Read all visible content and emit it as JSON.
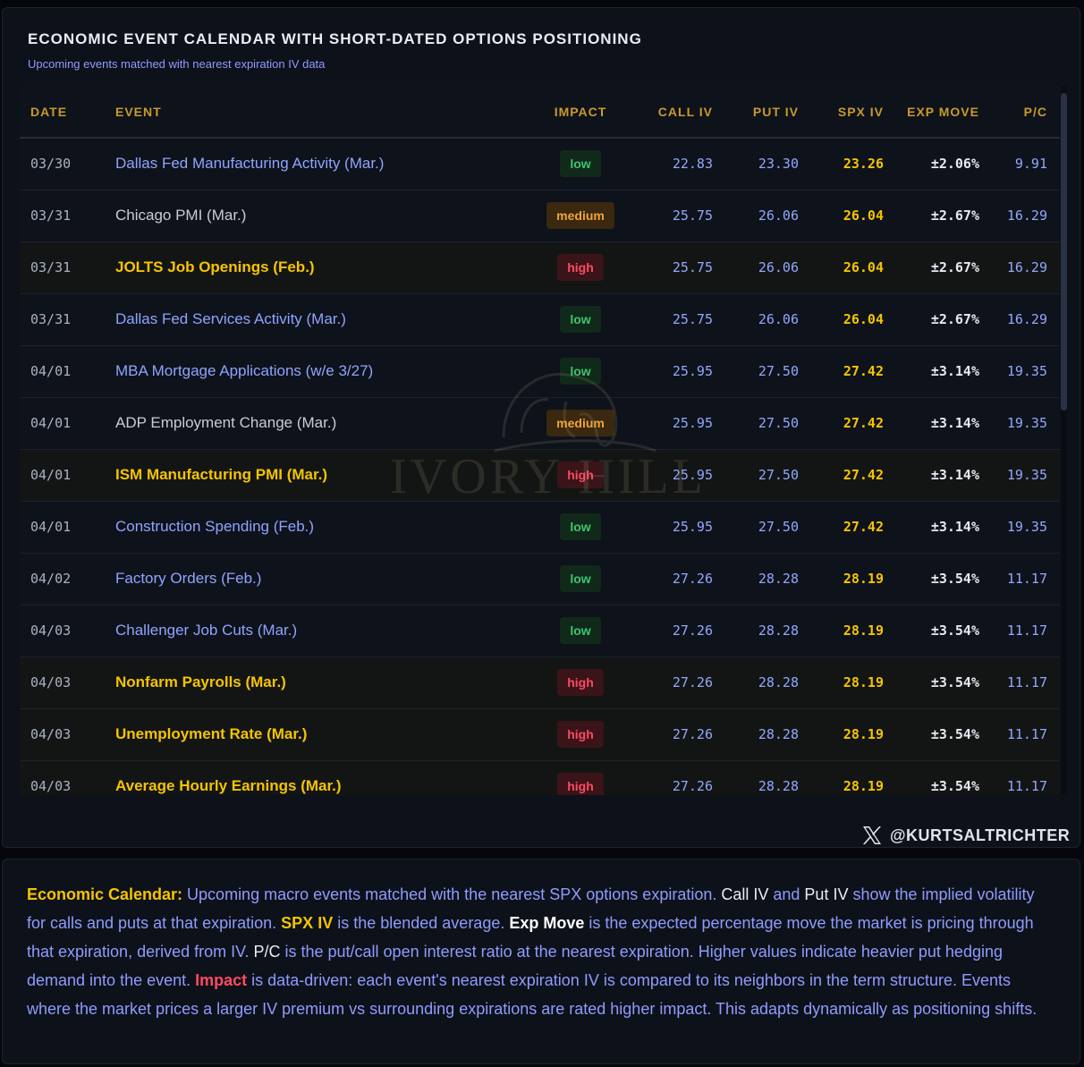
{
  "header": {
    "title": "ECONOMIC EVENT CALENDAR WITH SHORT-DATED OPTIONS POSITIONING",
    "subtitle": "Upcoming events matched with nearest expiration IV data"
  },
  "columns": [
    "DATE",
    "EVENT",
    "IMPACT",
    "CALL IV",
    "PUT IV",
    "SPX IV",
    "EXP MOVE",
    "P/C"
  ],
  "rows": [
    {
      "date": "03/30",
      "event": "Dallas Fed Manufacturing Activity (Mar.)",
      "impact": "low",
      "call_iv": "22.83",
      "put_iv": "23.30",
      "spx_iv": "23.26",
      "exp_move": "±2.06%",
      "pc": "9.91"
    },
    {
      "date": "03/31",
      "event": "Chicago PMI (Mar.)",
      "impact": "medium",
      "call_iv": "25.75",
      "put_iv": "26.06",
      "spx_iv": "26.04",
      "exp_move": "±2.67%",
      "pc": "16.29"
    },
    {
      "date": "03/31",
      "event": "JOLTS Job Openings (Feb.)",
      "impact": "high",
      "call_iv": "25.75",
      "put_iv": "26.06",
      "spx_iv": "26.04",
      "exp_move": "±2.67%",
      "pc": "16.29"
    },
    {
      "date": "03/31",
      "event": "Dallas Fed Services Activity (Mar.)",
      "impact": "low",
      "call_iv": "25.75",
      "put_iv": "26.06",
      "spx_iv": "26.04",
      "exp_move": "±2.67%",
      "pc": "16.29"
    },
    {
      "date": "04/01",
      "event": "MBA Mortgage Applications (w/e 3/27)",
      "impact": "low",
      "call_iv": "25.95",
      "put_iv": "27.50",
      "spx_iv": "27.42",
      "exp_move": "±3.14%",
      "pc": "19.35"
    },
    {
      "date": "04/01",
      "event": "ADP Employment Change (Mar.)",
      "impact": "medium",
      "call_iv": "25.95",
      "put_iv": "27.50",
      "spx_iv": "27.42",
      "exp_move": "±3.14%",
      "pc": "19.35"
    },
    {
      "date": "04/01",
      "event": "ISM Manufacturing PMI (Mar.)",
      "impact": "high",
      "call_iv": "25.95",
      "put_iv": "27.50",
      "spx_iv": "27.42",
      "exp_move": "±3.14%",
      "pc": "19.35"
    },
    {
      "date": "04/01",
      "event": "Construction Spending (Feb.)",
      "impact": "low",
      "call_iv": "25.95",
      "put_iv": "27.50",
      "spx_iv": "27.42",
      "exp_move": "±3.14%",
      "pc": "19.35"
    },
    {
      "date": "04/02",
      "event": "Factory Orders (Feb.)",
      "impact": "low",
      "call_iv": "27.26",
      "put_iv": "28.28",
      "spx_iv": "28.19",
      "exp_move": "±3.54%",
      "pc": "11.17"
    },
    {
      "date": "04/03",
      "event": "Challenger Job Cuts (Mar.)",
      "impact": "low",
      "call_iv": "27.26",
      "put_iv": "28.28",
      "spx_iv": "28.19",
      "exp_move": "±3.54%",
      "pc": "11.17"
    },
    {
      "date": "04/03",
      "event": "Nonfarm Payrolls (Mar.)",
      "impact": "high",
      "call_iv": "27.26",
      "put_iv": "28.28",
      "spx_iv": "28.19",
      "exp_move": "±3.54%",
      "pc": "11.17"
    },
    {
      "date": "04/03",
      "event": "Unemployment Rate (Mar.)",
      "impact": "high",
      "call_iv": "27.26",
      "put_iv": "28.28",
      "spx_iv": "28.19",
      "exp_move": "±3.54%",
      "pc": "11.17"
    },
    {
      "date": "04/03",
      "event": "Average Hourly Earnings (Mar.)",
      "impact": "high",
      "call_iv": "27.26",
      "put_iv": "28.28",
      "spx_iv": "28.19",
      "exp_move": "±3.54%",
      "pc": "11.17"
    }
  ],
  "watermark": "IVORY HILL",
  "handle": {
    "icon": "x-logo-icon",
    "text": "@KURTSALTRICHTER"
  },
  "note": {
    "label": "Economic Calendar:",
    "t1": " Upcoming macro events matched with the nearest SPX options expiration. ",
    "call_iv": "Call IV",
    "t2": " and ",
    "put_iv": "Put IV",
    "t3": " show the implied volatility for calls and puts at that expiration. ",
    "spx_iv": "SPX IV",
    "t4": " is the blended average. ",
    "exp_move": "Exp Move",
    "t5": " is the expected percentage move the market is pricing through that expiration, derived from IV. ",
    "pc": "P/C",
    "t6": " is the put/call open interest ratio at the nearest expiration. Higher values indicate heavier put hedging demand into the event. ",
    "impact": "Impact",
    "t7": " is data-driven: each event's nearest expiration IV is compared to its neighbors in the term structure. Events where the market prices a larger IV premium vs surrounding expirations are rated higher impact. This adapts dynamically as positioning shifts."
  },
  "colors": {
    "background": "#0d1119",
    "accent_gold": "#f5c400",
    "accent_blue": "#8e9cff",
    "impact_low": "#3ec46d",
    "impact_medium": "#f0a43a",
    "impact_high": "#ff4a62"
  }
}
